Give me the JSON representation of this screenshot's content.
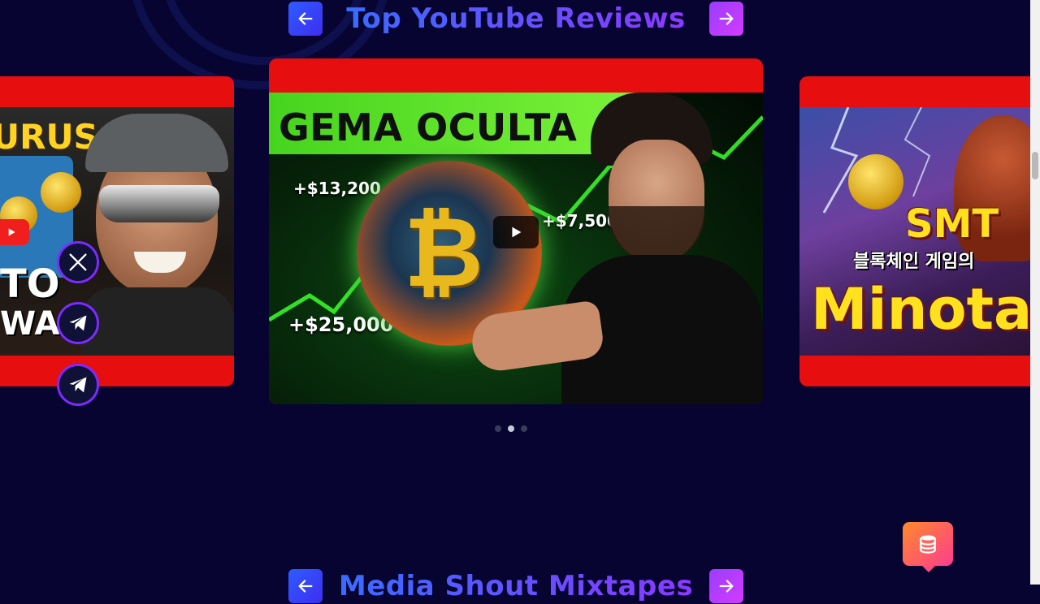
{
  "section_top": {
    "title": "Top YouTube Reviews",
    "prev_icon": "arrow-left-icon",
    "next_icon": "arrow-right-icon"
  },
  "cards": {
    "left": {
      "word_top": "URUS",
      "word_mid": "TO",
      "word_bot": "WAIT"
    },
    "center": {
      "headline": "GEMA OCULTA",
      "gain_1": "+$13,200",
      "gain_2": "+$7,500",
      "gain_3": "+$25,000"
    },
    "right": {
      "title_top": "SMT",
      "korean_sub": "블록체인 게임의",
      "title_main": "Minota"
    }
  },
  "social_icons": [
    "x-icon",
    "telegram-icon",
    "telegram-icon"
  ],
  "carousel": {
    "dots": 3,
    "active_index": 1
  },
  "section_bottom": {
    "title": "Media Shout Mixtapes"
  },
  "colors": {
    "background": "#070432",
    "card_frame": "#e60e0e",
    "title_gradient_start": "#3a6bff",
    "title_gradient_end": "#8a39ff",
    "thumbnail_green": "#46d41e"
  }
}
